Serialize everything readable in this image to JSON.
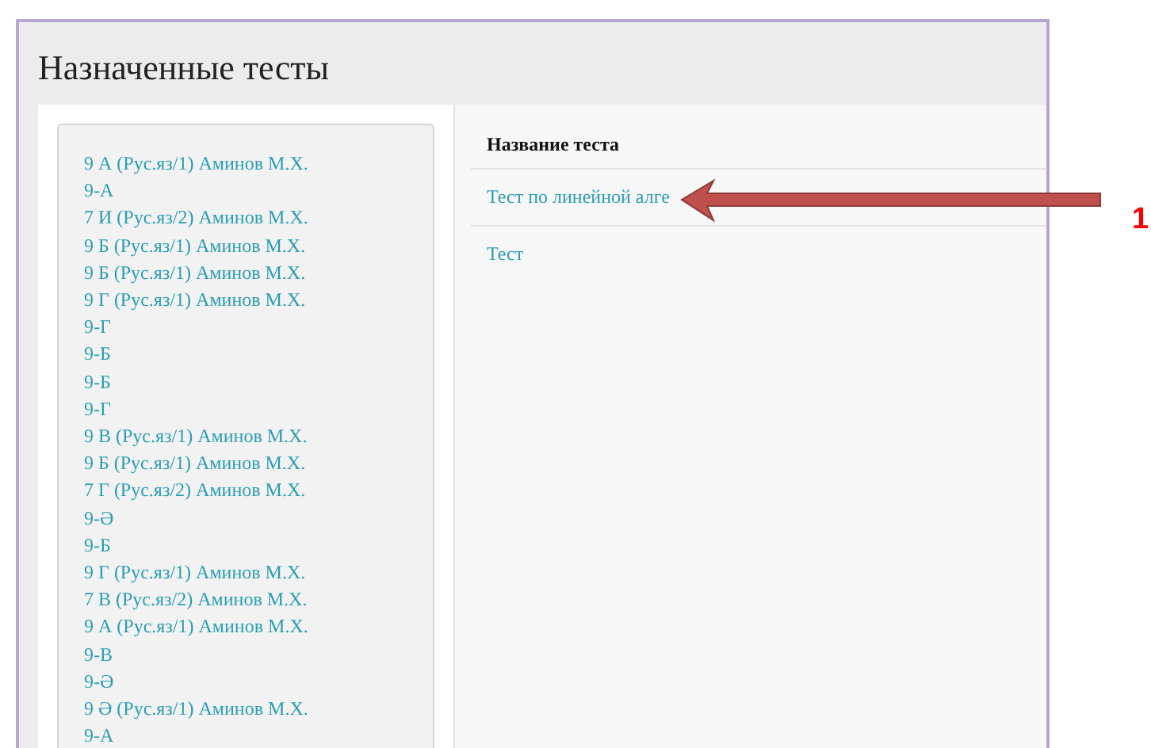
{
  "title": "Назначенные тесты",
  "classes": [
    "9 А (Рус.яз/1) Аминов М.Х.",
    "9-А",
    "7 И (Рус.яз/2) Аминов М.Х.",
    "9 Б (Рус.яз/1) Аминов М.Х.",
    "9 Б (Рус.яз/1) Аминов М.Х.",
    "9 Г (Рус.яз/1) Аминов М.Х.",
    "9-Г",
    "9-Б",
    "9-Б",
    "9-Г",
    "9 В (Рус.яз/1) Аминов М.Х.",
    "9 Б (Рус.яз/1) Аминов М.Х.",
    "7 Г (Рус.яз/2) Аминов М.Х.",
    "9-Ә",
    "9-Б",
    "9 Г (Рус.яз/1) Аминов М.Х.",
    "7 В (Рус.яз/2) Аминов М.Х.",
    "9 А (Рус.яз/1) Аминов М.Х.",
    "9-В",
    "9-Ә",
    "9 Ә (Рус.яз/1) Аминов М.Х.",
    "9-А"
  ],
  "table": {
    "column": "Название теста",
    "rows": [
      "Тест по линейной алге",
      "Тест"
    ]
  },
  "annotation": {
    "label": "1"
  }
}
